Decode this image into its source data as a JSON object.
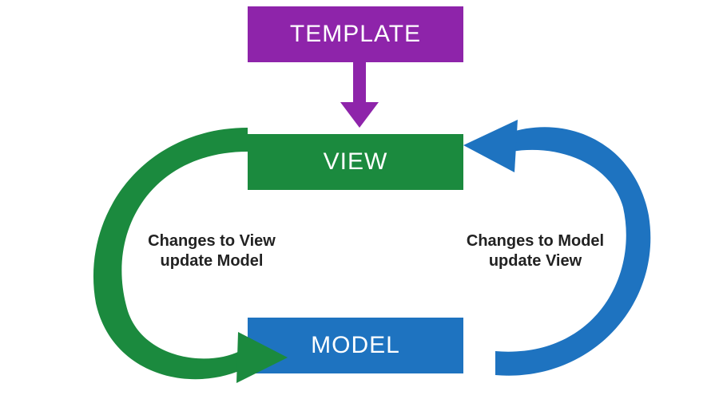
{
  "colors": {
    "template": "#8e24aa",
    "view": "#1b8a3e",
    "model": "#1e73c0",
    "text_on_box": "#ffffff",
    "label": "#222222"
  },
  "boxes": {
    "template": {
      "label": "TEMPLATE"
    },
    "view": {
      "label": "VIEW"
    },
    "model": {
      "label": "MODEL"
    }
  },
  "captions": {
    "left": {
      "line1": "Changes to View",
      "line2": "update Model"
    },
    "right": {
      "line1": "Changes to Model",
      "line2": "update View"
    }
  },
  "arrows": {
    "template_to_view": {
      "color_key": "template"
    },
    "view_to_model": {
      "color_key": "view"
    },
    "model_to_view": {
      "color_key": "model"
    }
  }
}
